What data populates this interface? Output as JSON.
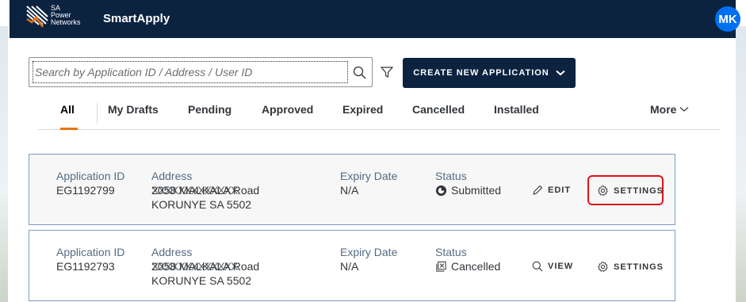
{
  "header": {
    "logo_lines": [
      "SA",
      "Power",
      "Networks"
    ],
    "app_title": "SmartApply",
    "avatar_initials": "MK"
  },
  "toolbar": {
    "search_placeholder": "Search by Application ID / Address / User ID",
    "create_label": "CREATE NEW APPLICATION"
  },
  "tabs": [
    {
      "label": "All",
      "selected": true
    },
    {
      "label": "My Drafts"
    },
    {
      "label": "Pending"
    },
    {
      "label": "Approved"
    },
    {
      "label": "Expired"
    },
    {
      "label": "Cancelled"
    },
    {
      "label": "Installed"
    },
    {
      "label": "More"
    }
  ],
  "columns": {
    "app_id": "Application ID",
    "address": "Address",
    "expiry": "Expiry Date",
    "status": "Status"
  },
  "applications": [
    {
      "id": "EG1192799",
      "address_line1": "2058 MALKALA Road",
      "address_mask": "XXXXXXXXXXXXX",
      "address_line2": "KORUNYE SA 5502",
      "expiry": "N/A",
      "status": "Submitted",
      "action": "EDIT",
      "settings": "SETTINGS"
    },
    {
      "id": "EG1192793",
      "address_line1": "2058 MALKALA Road",
      "address_mask": "XXXXXXXXXXXXX",
      "address_line2": "KORUNYE SA 5502",
      "expiry": "N/A",
      "status": "Cancelled",
      "action": "VIEW",
      "settings": "SETTINGS"
    }
  ],
  "colors": {
    "header_bg": "#0c2340",
    "avatar_bg": "#0070f2",
    "tab_accent": "#e9730c",
    "highlight": "#e0121b",
    "row_border": "#7f9bbf"
  }
}
